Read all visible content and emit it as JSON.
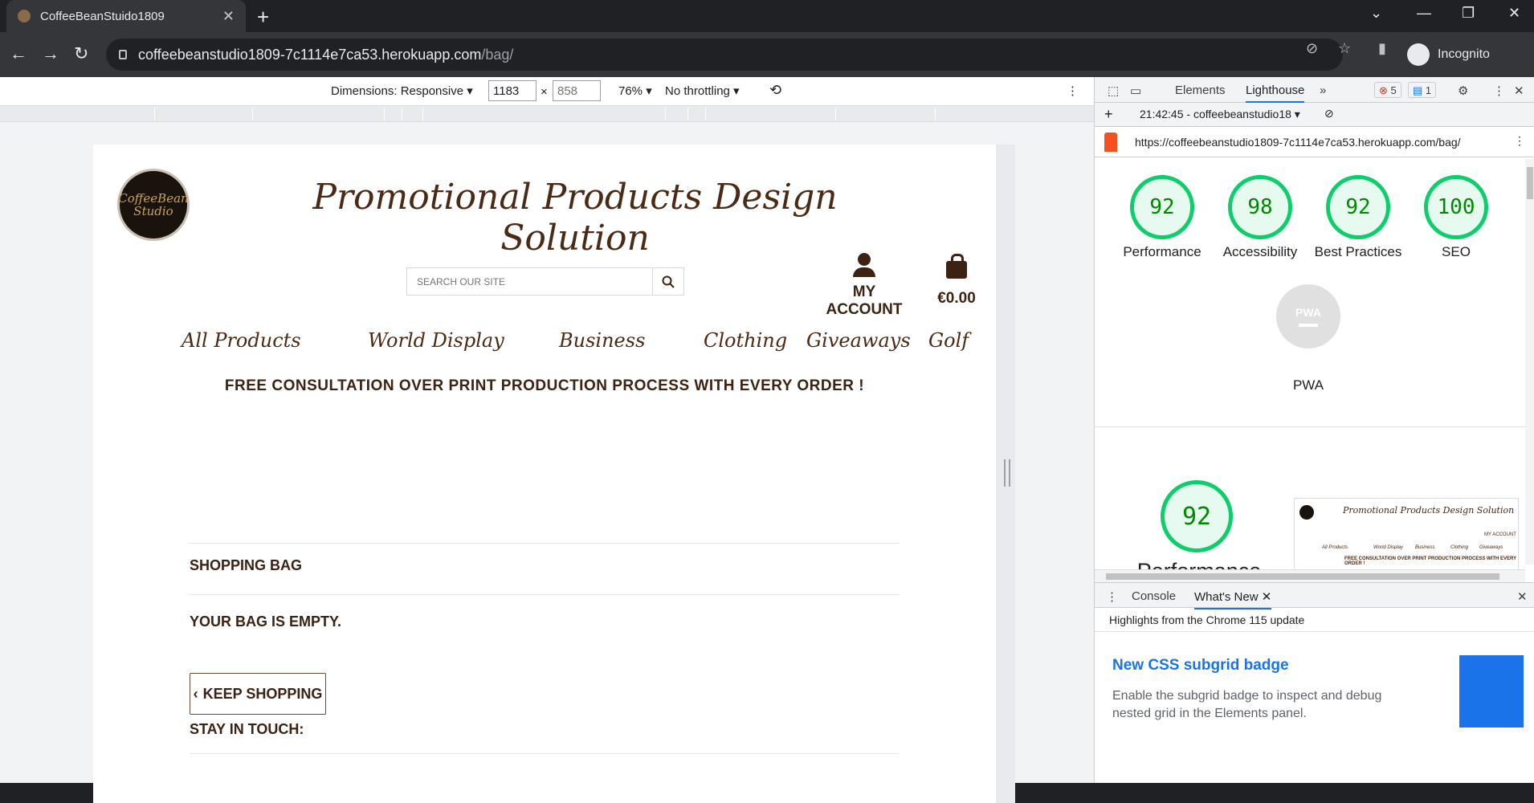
{
  "browser": {
    "tab_title": "CoffeeBeanStuido1809",
    "url_host": "coffeebeanstudio1809-7c1114e7ca53.herokuapp.com",
    "url_path": "/bag/",
    "profile_label": "Incognito"
  },
  "device_toolbar": {
    "dimensions_label": "Dimensions: Responsive",
    "width_value": "1183",
    "height_placeholder": "858",
    "zoom": "76%",
    "throttling": "No throttling"
  },
  "site": {
    "logo_text": "CoffeeBean Studio",
    "title": "Promotional Products Design Solution",
    "search_placeholder": "SEARCH OUR SITE",
    "account_label": "MY ACCOUNT",
    "bag_total": "€0.00",
    "nav": [
      "All Products",
      "World Display",
      "Business",
      "Clothing",
      "Giveaways",
      "Golf"
    ],
    "promo": "FREE CONSULTATION OVER PRINT PRODUCTION PROCESS WITH EVERY ORDER !",
    "shopping_bag_heading": "SHOPPING BAG",
    "empty_message": "YOUR BAG IS EMPTY.",
    "keep_shopping": "KEEP SHOPPING",
    "stay_in_touch": "STAY IN TOUCH:"
  },
  "devtools": {
    "tabs": [
      "Elements",
      "Lighthouse"
    ],
    "active_tab": "Lighthouse",
    "error_count": "5",
    "message_count": "1",
    "report_selector": "21:42:45 - coffeebeanstudio18",
    "report_url": "https://coffeebeanstudio1809-7c1114e7ca53.herokuapp.com/bag/",
    "scores": [
      {
        "label": "Performance",
        "value": "92"
      },
      {
        "label": "Accessibility",
        "value": "98"
      },
      {
        "label": "Best Practices",
        "value": "92"
      },
      {
        "label": "SEO",
        "value": "100"
      }
    ],
    "pwa_label": "PWA",
    "pwa_badge": "PWA",
    "big_score": "92",
    "big_label": "Performance",
    "drawer_tabs": [
      "Console",
      "What's New"
    ],
    "highlights": "Highlights from the Chrome 115 update",
    "whats_new_title": "New CSS subgrid badge",
    "whats_new_desc": "Enable the subgrid badge to inspect and debug nested grid in the Elements panel."
  },
  "thumbnail": {
    "account": "MY ACCOUNT",
    "nav": [
      "All Products",
      "World Display",
      "Business",
      "Clothing",
      "Giveaways"
    ],
    "promo": "FREE CONSULTATION OVER PRINT PRODUCTION PROCESS WITH EVERY ORDER !"
  },
  "colors": {
    "brand_brown": "#3b2212",
    "score_green": "#0cce6b",
    "devtools_accent": "#1a73e8"
  }
}
